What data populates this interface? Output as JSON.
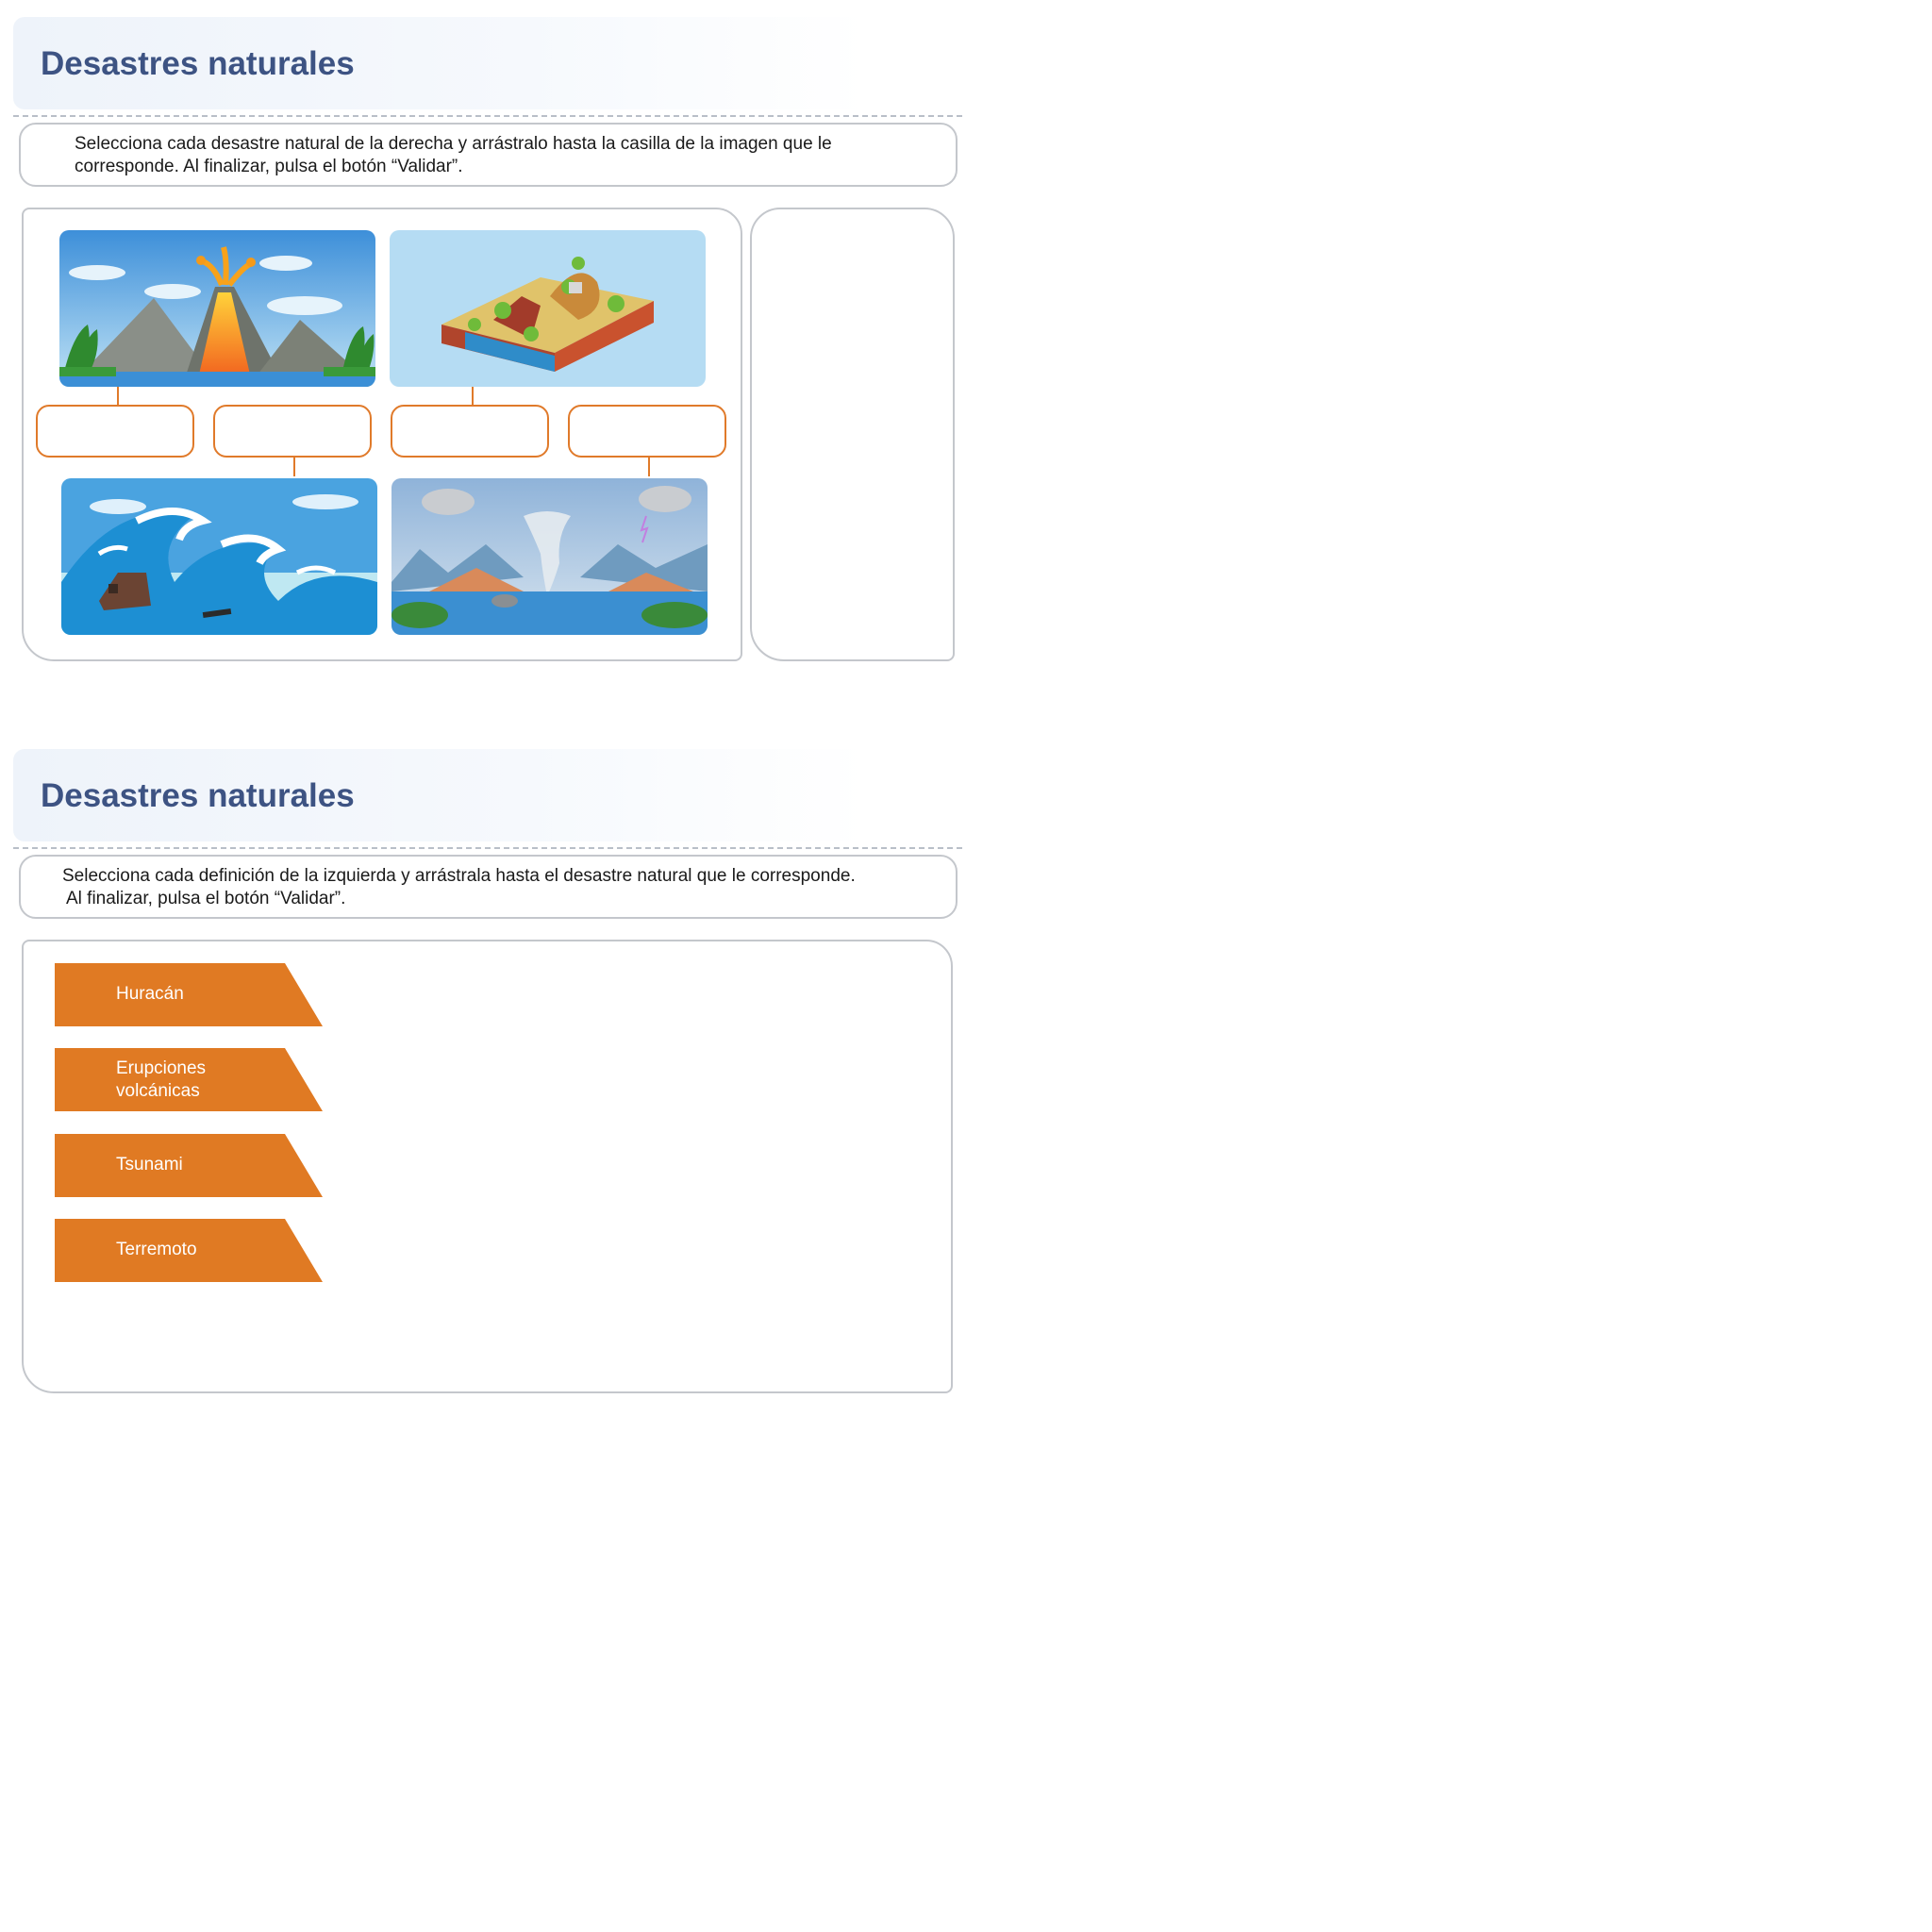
{
  "section1": {
    "title": "Desastres naturales",
    "instruction_line1": "Selecciona cada desastre natural de la derecha y arrástralo hasta la casilla de la imagen que le",
    "instruction_line2": "corresponde. Al finalizar, pulsa el botón “Validar”.",
    "images": [
      {
        "name": "volcano-image"
      },
      {
        "name": "earthquake-image"
      },
      {
        "name": "tsunami-image"
      },
      {
        "name": "hurricane-image"
      }
    ],
    "drop_slots": 4
  },
  "section2": {
    "title": "Desastres naturales",
    "instruction_line1": "Selecciona cada definición de la izquierda y arrástrala hasta el desastre natural que le corresponde.",
    "instruction_line2": "Al finalizar, pulsa el botón “Validar”.",
    "tags": [
      {
        "line1": "Huracán",
        "line2": ""
      },
      {
        "line1": "Erupciones",
        "line2": "volcánicas"
      },
      {
        "line1": "Tsunami",
        "line2": ""
      },
      {
        "line1": "Terremoto",
        "line2": ""
      }
    ]
  },
  "colors": {
    "title": "#3d5383",
    "accent": "#e07a23",
    "border": "#c4c7cc"
  }
}
